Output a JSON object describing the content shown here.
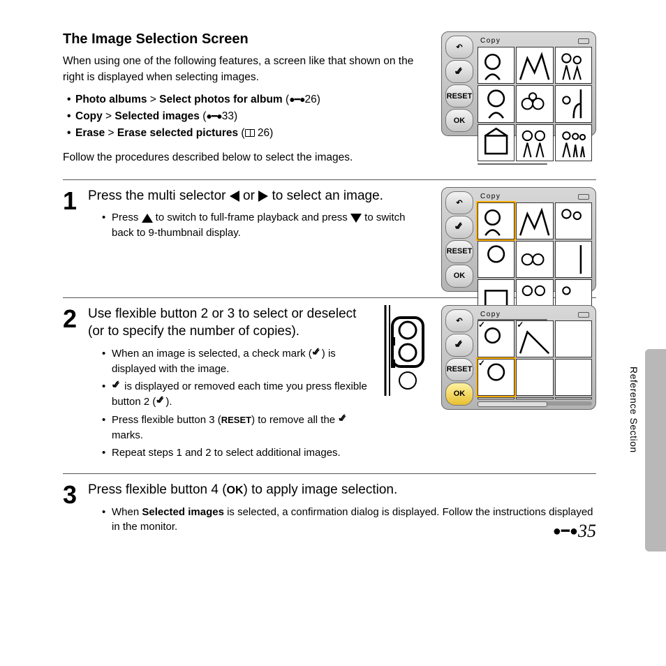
{
  "heading": "The Image Selection Screen",
  "intro": "When using one of the following features, a screen like that shown on the right is displayed when selecting images.",
  "features": {
    "f1a": "Photo albums",
    "f1b": "Select photos for album",
    "f1ref": "26",
    "f2a": "Copy",
    "f2b": "Selected images",
    "f2ref": "33",
    "f3a": "Erase",
    "f3b": "Erase selected pictures",
    "f3ref": " 26"
  },
  "follow": "Follow the procedures described below to select the images.",
  "screen": {
    "title": "Copy",
    "btn_reset": "RESET",
    "btn_ok": "OK"
  },
  "step1": {
    "num": "1",
    "title_a": "Press the multi selector ",
    "title_b": " or ",
    "title_c": " to select an image.",
    "sub1a": "Press ",
    "sub1b": " to switch to full-frame playback and press ",
    "sub1c": " to switch back to 9-thumbnail display."
  },
  "step2": {
    "num": "2",
    "title": "Use flexible button 2 or 3 to select or deselect (or to specify the number of copies).",
    "sub1a": "When an image is selected, a check mark (",
    "sub1b": ") is displayed with the image.",
    "sub2a": " is displayed or removed each time you press flexible button 2 (",
    "sub2b": ").",
    "sub3a": "Press flexible button 3 (",
    "sub3b": ") to remove all the ",
    "sub3c": " marks.",
    "sub4": "Repeat steps 1 and 2 to select additional images."
  },
  "step3": {
    "num": "3",
    "title_a": "Press flexible button 4 (",
    "title_b": ") to apply image selection.",
    "sub1a": "When ",
    "sub1b": "Selected images",
    "sub1c": " is selected, a confirmation dialog is displayed. Follow the instructions displayed in the monitor."
  },
  "side_label": "Reference Section",
  "page_number": "35"
}
